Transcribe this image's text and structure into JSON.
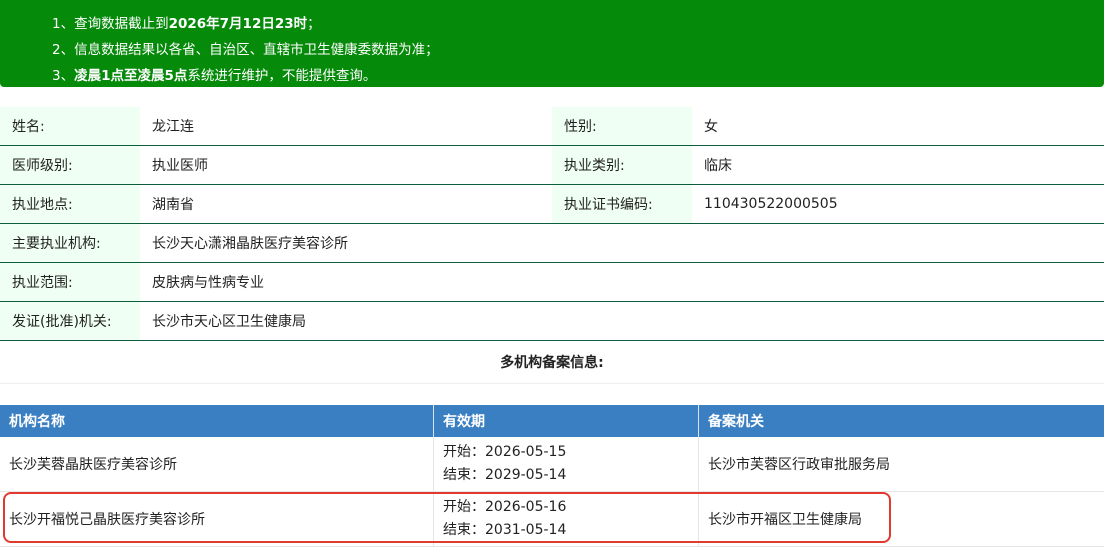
{
  "notice": {
    "line1_pre": "1、查询数据截止到",
    "line1_bold": "2026年7月12日23时",
    "line1_post": "；",
    "line2": "2、信息数据结果以各省、自治区、直辖市卫生健康委数据为准；",
    "line3_pre": "3、",
    "line3_bold": "凌晨1点至凌晨5点",
    "line3_post": "系统进行维护，不能提供查询。"
  },
  "info": {
    "name_label": "姓名:",
    "name_value": "龙江连",
    "gender_label": "性别:",
    "gender_value": "女",
    "level_label": "医师级别:",
    "level_value": "执业医师",
    "category_label": "执业类别:",
    "category_value": "临床",
    "location_label": "执业地点:",
    "location_value": "湖南省",
    "cert_label": "执业证书编码:",
    "cert_value": "110430522000505",
    "org_label": "主要执业机构:",
    "org_value": "长沙天心潇湘晶肤医疗美容诊所",
    "scope_label": "执业范围:",
    "scope_value": "皮肤病与性病专业",
    "issuer_label": "发证(批准)机关:",
    "issuer_value": "长沙市天心区卫生健康局"
  },
  "multi_title": "多机构备案信息:",
  "records": {
    "headers": [
      "机构名称",
      "有效期",
      "备案机关"
    ],
    "rows": [
      {
        "org": "长沙芙蓉晶肤医疗美容诊所",
        "start": "开始：2026-05-15",
        "end": "结束：2029-05-14",
        "authority": "长沙市芙蓉区行政审批服务局"
      },
      {
        "org": "长沙开福悦己晶肤医疗美容诊所",
        "start": "开始：2026-05-16",
        "end": "结束：2031-05-14",
        "authority": "长沙市开福区卫生健康局"
      }
    ]
  },
  "colors": {
    "notice_bg": "#068a0a",
    "table_header_bg": "#3a7fc1",
    "label_bg": "#f0fff3",
    "highlight": "#e03a2e"
  }
}
